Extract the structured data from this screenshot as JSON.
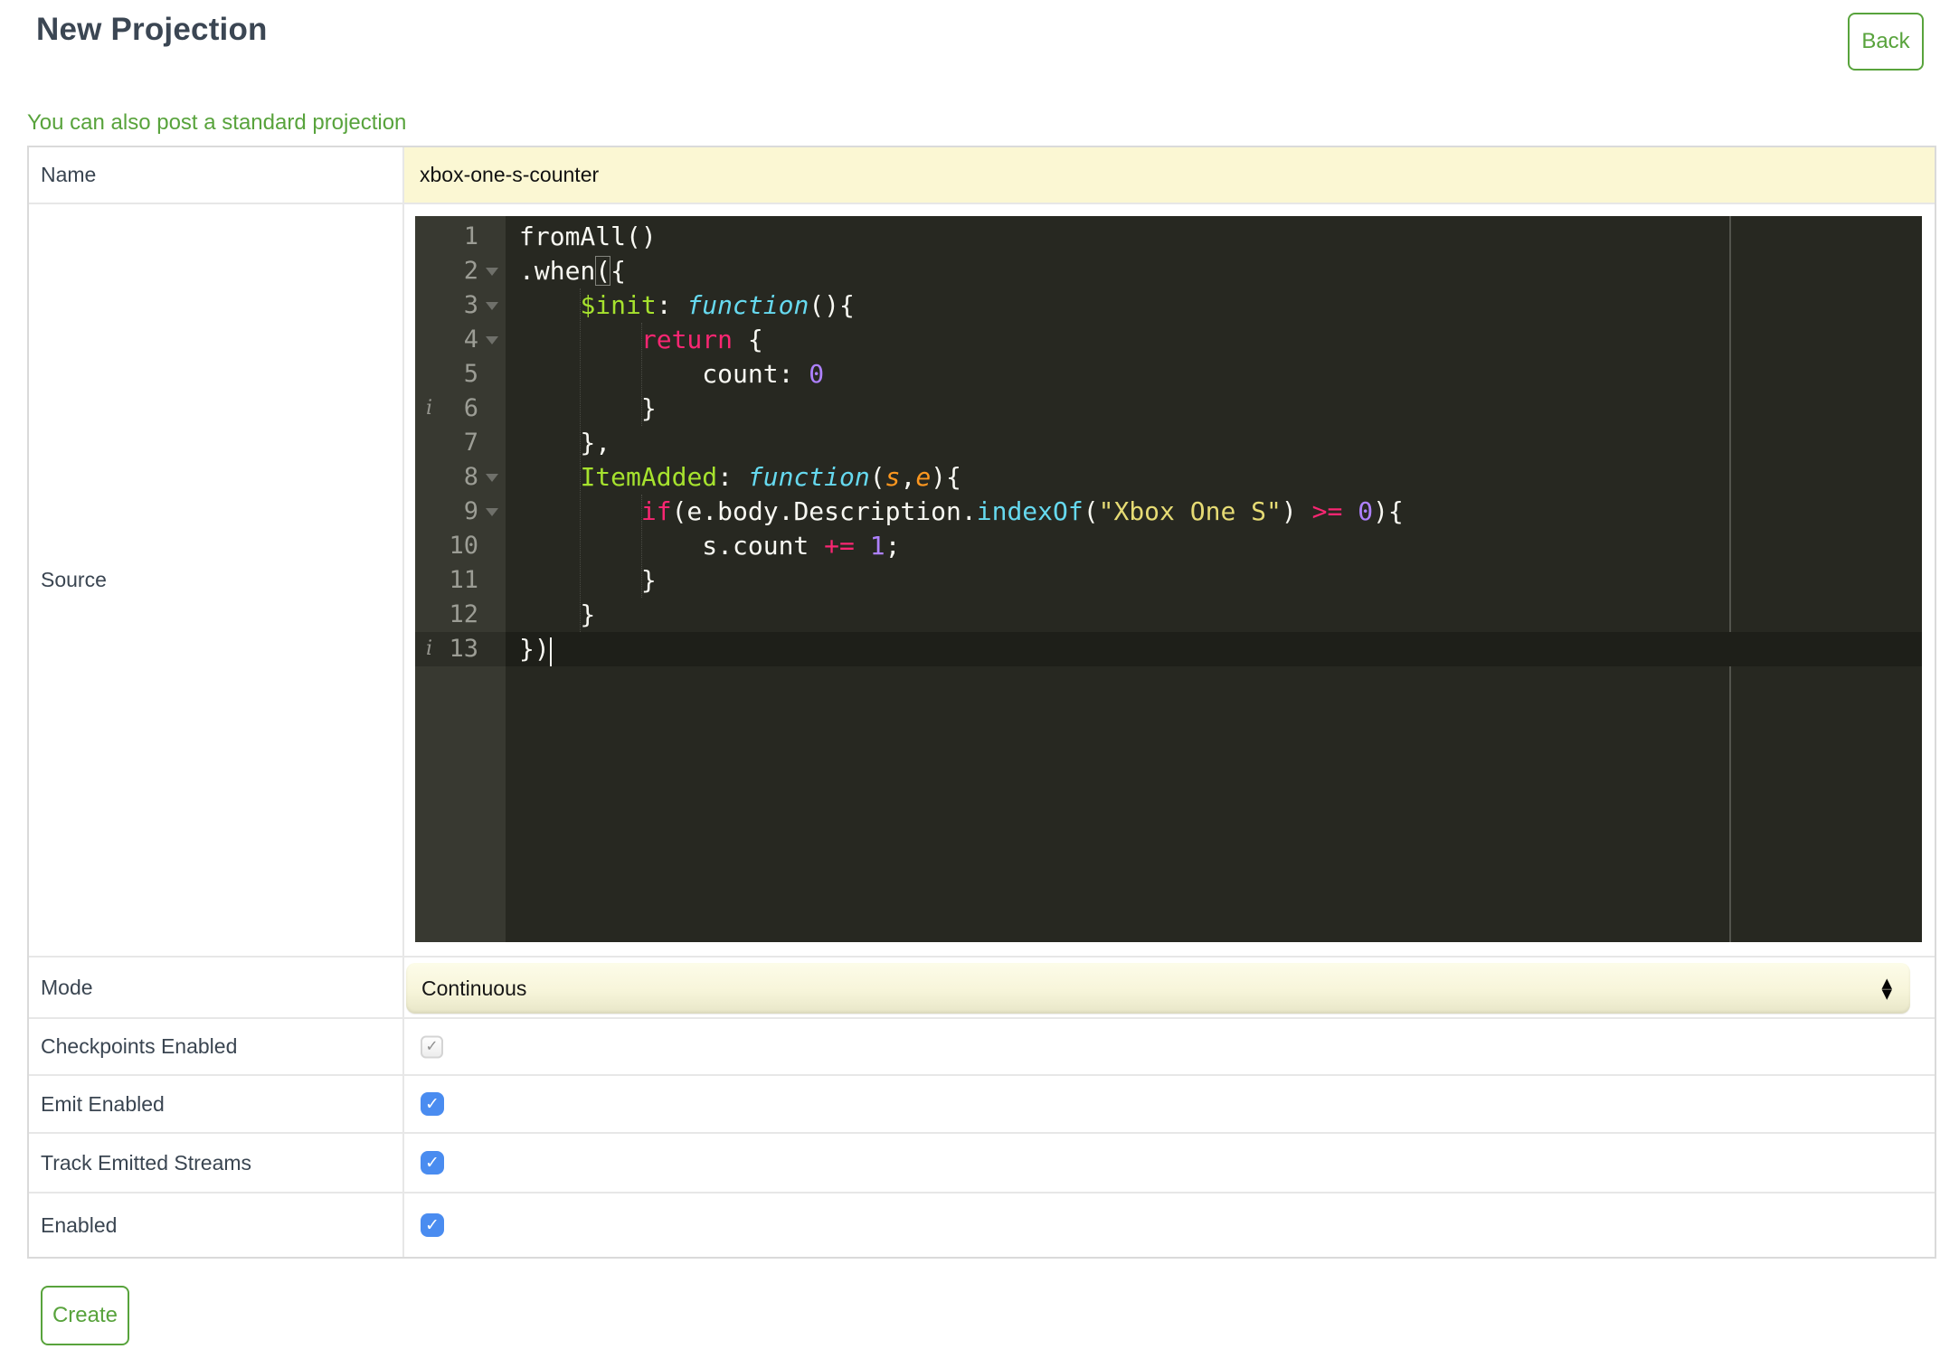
{
  "header": {
    "title": "New Projection",
    "back_label": "Back",
    "link_text": "You can also post a standard projection"
  },
  "form": {
    "name": {
      "label": "Name",
      "value": "xbox-one-s-counter"
    },
    "source": {
      "label": "Source"
    },
    "mode": {
      "label": "Mode",
      "value": "Continuous"
    },
    "checkpoints": {
      "label": "Checkpoints Enabled",
      "checked": true,
      "disabled": true
    },
    "emit": {
      "label": "Emit Enabled",
      "checked": true
    },
    "track": {
      "label": "Track Emitted Streams",
      "checked": true
    },
    "enabled": {
      "label": "Enabled",
      "checked": true
    },
    "create_label": "Create"
  },
  "icons": {
    "check": "✓",
    "select_up": "▲",
    "select_down": "▼",
    "annotation": "i"
  },
  "colors": {
    "accent_green": "#58a33c",
    "title_slate": "#3b4653",
    "input_yellow": "#fbf7d3",
    "checkbox_blue": "#4a8cf0",
    "editor_bg": "#272821",
    "editor_gutter": "#383931",
    "active_line": "#1e1f19"
  },
  "editor": {
    "active_line": 13,
    "cursor": {
      "line": 13,
      "col": 2
    },
    "annotation_lines": [
      6,
      13
    ],
    "fold_lines": [
      2,
      3,
      4,
      8,
      9
    ],
    "token_colors": {
      "p": "#f8f8f2",
      "prop": "#a6e22e",
      "kw": "#f92672",
      "fnkw": "#66d9ef",
      "call": "#66d9ef",
      "num": "#ae81ff",
      "str": "#e6db74",
      "param": "#fd971f",
      "brkt": "#f8f8f2"
    },
    "lines": [
      {
        "n": 1,
        "tokens": [
          [
            "fromAll()",
            "p"
          ]
        ]
      },
      {
        "n": 2,
        "tokens": [
          [
            ".when",
            "p"
          ],
          [
            "(",
            "brkt"
          ],
          [
            "{",
            "p"
          ]
        ]
      },
      {
        "n": 3,
        "tokens": [
          [
            "    ",
            "p"
          ],
          [
            "$init",
            "prop"
          ],
          [
            ": ",
            "p"
          ],
          [
            "function",
            "fnkw"
          ],
          [
            "(){",
            "p"
          ]
        ]
      },
      {
        "n": 4,
        "tokens": [
          [
            "        ",
            "p"
          ],
          [
            "return",
            "kw"
          ],
          [
            " {",
            "p"
          ]
        ]
      },
      {
        "n": 5,
        "tokens": [
          [
            "            count: ",
            "p"
          ],
          [
            "0",
            "num"
          ]
        ]
      },
      {
        "n": 6,
        "tokens": [
          [
            "        }",
            "p"
          ]
        ]
      },
      {
        "n": 7,
        "tokens": [
          [
            "    },",
            "p"
          ]
        ]
      },
      {
        "n": 8,
        "tokens": [
          [
            "    ",
            "p"
          ],
          [
            "ItemAdded",
            "prop"
          ],
          [
            ": ",
            "p"
          ],
          [
            "function",
            "fnkw"
          ],
          [
            "(",
            "p"
          ],
          [
            "s",
            "param"
          ],
          [
            ",",
            "p"
          ],
          [
            "e",
            "param"
          ],
          [
            "){",
            "p"
          ]
        ]
      },
      {
        "n": 9,
        "tokens": [
          [
            "        ",
            "p"
          ],
          [
            "if",
            "kw"
          ],
          [
            "(e.body.Description.",
            "p"
          ],
          [
            "indexOf",
            "call"
          ],
          [
            "(",
            "p"
          ],
          [
            "\"Xbox One S\"",
            "str"
          ],
          [
            ") ",
            "p"
          ],
          [
            ">=",
            "kw"
          ],
          [
            " ",
            "p"
          ],
          [
            "0",
            "num"
          ],
          [
            "){",
            "p"
          ]
        ]
      },
      {
        "n": 10,
        "tokens": [
          [
            "            s.count ",
            "p"
          ],
          [
            "+=",
            "kw"
          ],
          [
            " ",
            "p"
          ],
          [
            "1",
            "num"
          ],
          [
            ";",
            "p"
          ]
        ]
      },
      {
        "n": 11,
        "tokens": [
          [
            "        }",
            "p"
          ]
        ]
      },
      {
        "n": 12,
        "tokens": [
          [
            "    }",
            "p"
          ]
        ]
      },
      {
        "n": 13,
        "tokens": [
          [
            "})",
            "p"
          ]
        ]
      }
    ]
  }
}
